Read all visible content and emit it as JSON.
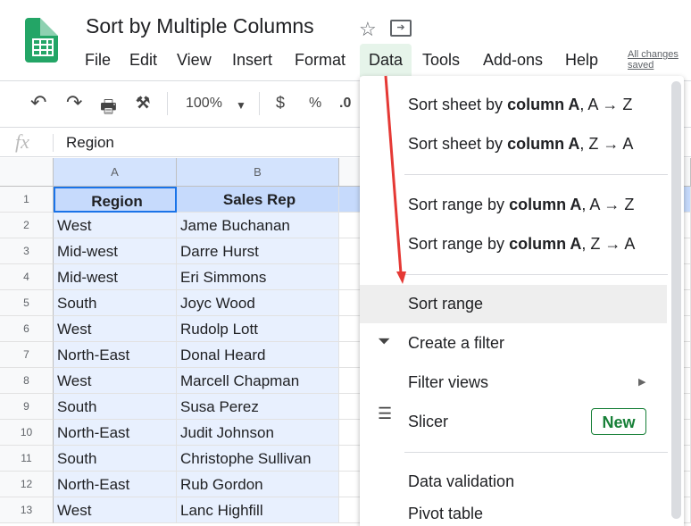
{
  "app": {
    "title": "Sort by Multiple Columns",
    "save_status": "All changes saved"
  },
  "menu": [
    "File",
    "Edit",
    "View",
    "Insert",
    "Format",
    "Data",
    "Tools",
    "Add-ons",
    "Help"
  ],
  "toolbar": {
    "zoom": "100%",
    "currency": "$",
    "percent": "%",
    "decimal": ".0"
  },
  "formula_bar": {
    "fx": "fx",
    "value": "Region"
  },
  "columns": [
    "A",
    "B"
  ],
  "header": [
    "Region",
    "Sales Rep"
  ],
  "rows": [
    [
      "2",
      "West",
      "Jame Buchanan"
    ],
    [
      "3",
      "Mid-west",
      "Darre Hurst"
    ],
    [
      "4",
      "Mid-west",
      "Eri Simmons"
    ],
    [
      "5",
      "South",
      "Joyc Wood"
    ],
    [
      "6",
      "West",
      "Rudolp Lott"
    ],
    [
      "7",
      "North-East",
      "Donal Heard"
    ],
    [
      "8",
      "West",
      "Marcell Chapman"
    ],
    [
      "9",
      "South",
      "Susa Perez"
    ],
    [
      "10",
      "North-East",
      "Judit Johnson"
    ],
    [
      "11",
      "South",
      "Christophe Sullivan"
    ],
    [
      "12",
      "North-East",
      "Rub Gordon"
    ],
    [
      "13",
      "West",
      "Lanc Highfill"
    ]
  ],
  "data_menu": {
    "sort_sheet_az": {
      "pre": "Sort sheet by ",
      "bold": "column A",
      ",post": ", A → Z",
      "post": ", A → Z"
    },
    "sort_sheet_za": {
      "pre": "Sort sheet by ",
      "bold": "column A",
      "post": ", Z → A"
    },
    "sort_range_az": {
      "pre": "Sort range by ",
      "bold": "column A",
      "post": ", A → Z"
    },
    "sort_range_za": {
      "pre": "Sort range by ",
      "bold": "column A",
      "post": ", Z → A"
    },
    "sort_range": "Sort range",
    "create_filter": "Create a filter",
    "filter_views": "Filter views",
    "slicer": "Slicer",
    "new_badge": "New",
    "data_validation": "Data validation",
    "pivot_table": "Pivot table"
  },
  "colors": {
    "accent": "#188038",
    "arrow": "#e53935",
    "selection": "#e8f0fe"
  }
}
